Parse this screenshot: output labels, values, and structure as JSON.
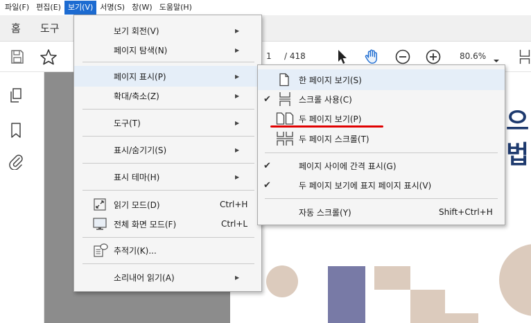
{
  "menubar": {
    "items": [
      "파일(F)",
      "편집(E)",
      "보기(V)",
      "서명(S)",
      "창(W)",
      "도움말(H)"
    ],
    "active_index": 2
  },
  "tabs": {
    "home": "홈",
    "tools": "도구"
  },
  "toolbar": {
    "page_current": "1",
    "page_total": "/ 418",
    "zoom": "80.6%"
  },
  "document": {
    "text_line1": "으",
    "text_line2": "법"
  },
  "view_menu": {
    "items": [
      {
        "label": "보기 회전(V)",
        "submenu": true
      },
      {
        "label": "페이지 탐색(N)",
        "submenu": true
      },
      {
        "label": "페이지 표시(P)",
        "submenu": true
      },
      {
        "label": "확대/축소(Z)",
        "submenu": true
      },
      {
        "label": "도구(T)",
        "submenu": true
      },
      {
        "label": "표시/숨기기(S)",
        "submenu": true
      },
      {
        "label": "표시 테마(H)",
        "submenu": true
      },
      {
        "label": "읽기 모드(D)",
        "shortcut": "Ctrl+H"
      },
      {
        "label": "전체 화면 모드(F)",
        "shortcut": "Ctrl+L"
      },
      {
        "label": "추적기(K)..."
      },
      {
        "label": "소리내어 읽기(A)",
        "submenu": true
      }
    ]
  },
  "page_display_menu": {
    "items": [
      {
        "label": "한 페이지 보기(S)",
        "icon": "single-page-icon"
      },
      {
        "label": "스크롤 사용(C)",
        "icon": "scroll-icon",
        "checked": true
      },
      {
        "label": "두 페이지 보기(P)",
        "icon": "two-page-icon"
      },
      {
        "label": "두 페이지 스크롤(T)",
        "icon": "two-page-scroll-icon"
      },
      {
        "label": "페이지 사이에 간격 표시(G)",
        "checked": true
      },
      {
        "label": "두 페이지 보기에 표지 페이지 표시(V)",
        "checked": true
      },
      {
        "label": "자동 스크롤(Y)",
        "shortcut": "Shift+Ctrl+H"
      }
    ]
  },
  "colors": {
    "highlight": "#e5eef8",
    "menubar_active": "#1c6bd1",
    "annotation": "#e00000",
    "doc_blue": "#1e3a6e"
  }
}
